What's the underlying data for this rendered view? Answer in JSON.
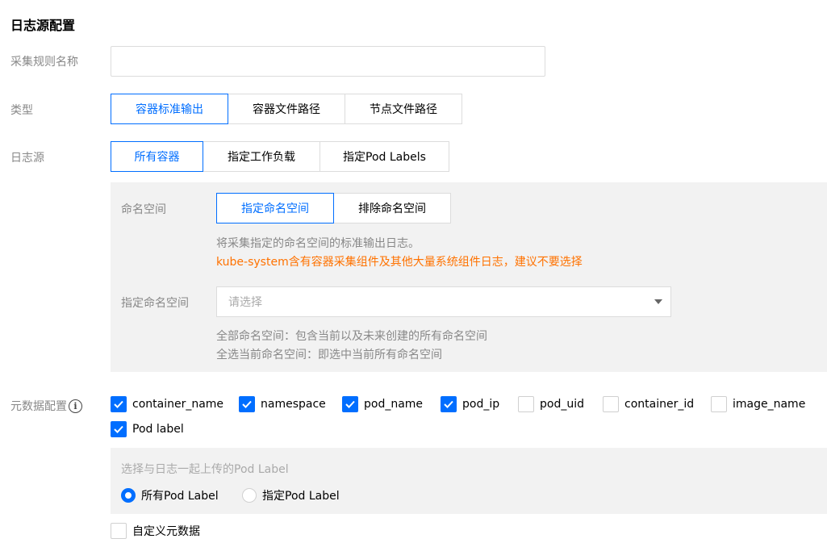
{
  "section_title": "日志源配置",
  "rule_name": {
    "label": "采集规则名称",
    "value": "",
    "placeholder": ""
  },
  "type": {
    "label": "类型",
    "options": [
      "容器标准输出",
      "容器文件路径",
      "节点文件路径"
    ],
    "selected": "容器标准输出"
  },
  "log_source": {
    "label": "日志源",
    "options": [
      "所有容器",
      "指定工作负载",
      "指定Pod Labels"
    ],
    "selected": "所有容器"
  },
  "namespace": {
    "label": "命名空间",
    "options": [
      "指定命名空间",
      "排除命名空间"
    ],
    "selected": "指定命名空间",
    "hint": "将采集指定的命名空间的标准输出日志。",
    "warning": "kube-system含有容器采集组件及其他大量系统组件日志，建议不要选择",
    "select_label": "指定命名空间",
    "select_placeholder": "请选择",
    "note1": "全部命名空间：包含当前以及未来创建的所有命名空间",
    "note2": "全选当前命名空间：即选中当前所有命名空间"
  },
  "metadata": {
    "label": "元数据配置",
    "info_icon": "info-icon",
    "items": [
      {
        "label": "container_name",
        "checked": true
      },
      {
        "label": "namespace",
        "checked": true
      },
      {
        "label": "pod_name",
        "checked": true
      },
      {
        "label": "pod_ip",
        "checked": true
      },
      {
        "label": "pod_uid",
        "checked": false
      },
      {
        "label": "container_id",
        "checked": false
      },
      {
        "label": "image_name",
        "checked": false
      },
      {
        "label": "Pod label",
        "checked": true
      }
    ],
    "pod_label_panel": {
      "title": "选择与日志一起上传的Pod Label",
      "options": [
        "所有Pod Label",
        "指定Pod Label"
      ],
      "selected": "所有Pod Label"
    },
    "custom": {
      "label": "自定义元数据",
      "checked": false
    }
  },
  "colors": {
    "accent": "#006eff",
    "warning": "#ff7200",
    "panel": "#f2f2f2"
  }
}
